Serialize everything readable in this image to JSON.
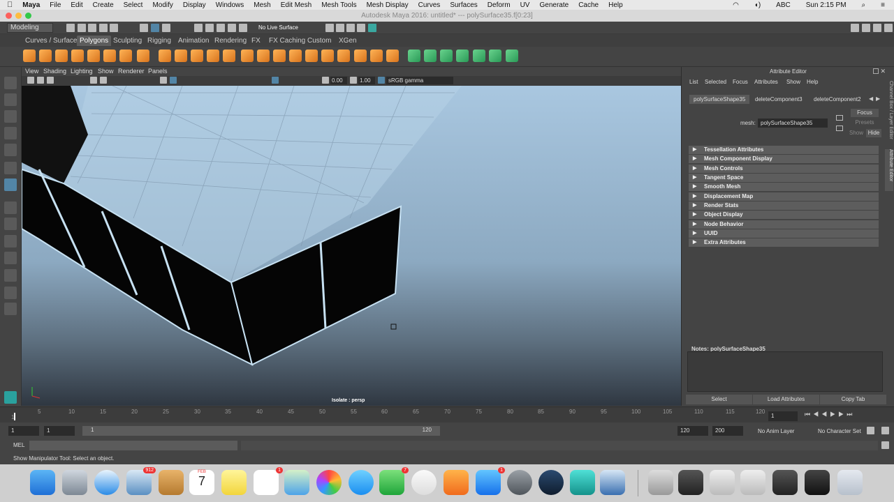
{
  "mac_menubar": {
    "items": [
      "Maya",
      "File",
      "Edit",
      "Create",
      "Select",
      "Modify",
      "Display",
      "Windows",
      "Mesh",
      "Edit Mesh",
      "Mesh Tools",
      "Mesh Display",
      "Curves",
      "Surfaces",
      "Deform",
      "UV",
      "Generate",
      "Cache",
      "Help"
    ],
    "clock": "Sun 2:15 PM",
    "input_source": "ABC"
  },
  "window": {
    "title": "Autodesk Maya 2016: untitled*   ---   polySurface35.f[0:23]"
  },
  "status_line": {
    "menu_set": "Modeling",
    "live_surface": "No Live Surface"
  },
  "shelf": {
    "tabs": [
      "Curves / Surfaces",
      "Polygons",
      "Sculpting",
      "Rigging",
      "Animation",
      "Rendering",
      "FX",
      "FX Caching",
      "Custom",
      "XGen"
    ],
    "active_tab": "Polygons"
  },
  "viewport": {
    "menu": [
      "View",
      "Shading",
      "Lighting",
      "Show",
      "Renderer",
      "Panels"
    ],
    "field_a": "0.00",
    "field_b": "1.00",
    "color_space": "sRGB gamma",
    "isolate_label": "Isolate : persp"
  },
  "attribute_editor": {
    "title": "Attribute Editor",
    "menu": [
      "List",
      "Selected",
      "Focus",
      "Attributes",
      "Show",
      "Help"
    ],
    "tabs": [
      "polySurfaceShape35",
      "deleteComponent3",
      "deleteComponent2"
    ],
    "mesh_label": "mesh:",
    "mesh_value": "polySurfaceShape35",
    "focus": "Focus",
    "presets": "Presets",
    "show": "Show",
    "hide": "Hide",
    "sections": [
      "Tessellation Attributes",
      "Mesh Component Display",
      "Mesh Controls",
      "Tangent Space",
      "Smooth Mesh",
      "Displacement Map",
      "Render Stats",
      "Object Display",
      "Node Behavior",
      "UUID",
      "Extra Attributes"
    ],
    "notes_label": "Notes:  polySurfaceShape35",
    "buttons": [
      "Select",
      "Load Attributes",
      "Copy Tab"
    ],
    "side_tabs": [
      "Channel Box / Layer Editor",
      "Attribute Editor"
    ]
  },
  "time_slider": {
    "ticks": [
      "5",
      "10",
      "15",
      "20",
      "25",
      "30",
      "35",
      "40",
      "45",
      "50",
      "55",
      "60",
      "65",
      "70",
      "75",
      "80",
      "85",
      "90",
      "95",
      "100",
      "105",
      "110",
      "115",
      "120"
    ],
    "first_tick": "1",
    "current_frame": "1"
  },
  "range_slider": {
    "start": "1",
    "range_start": "1",
    "range_handle_start": "1",
    "range_handle_end": "120",
    "range_end": "120",
    "end": "200",
    "anim_layer": "No Anim Layer",
    "character_set": "No Character Set"
  },
  "command_line": {
    "label": "MEL"
  },
  "help_line": {
    "text": "Show Manipulator Tool: Select an object."
  },
  "dock": {
    "badges": {
      "mail": "912",
      "messages": "7",
      "reminders": "1",
      "appstore": "1"
    },
    "calendar_day": "7",
    "calendar_month": "FEB"
  }
}
